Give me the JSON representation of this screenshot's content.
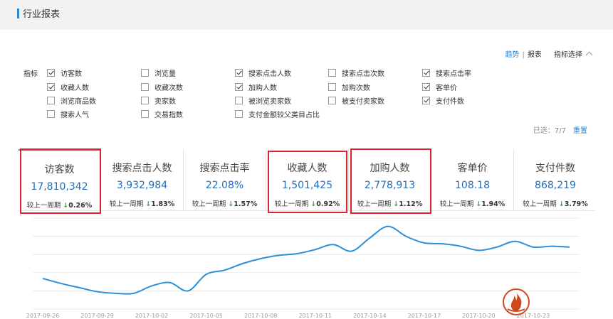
{
  "header": {
    "title": "行业报表"
  },
  "top_links": {
    "trend": "趋势",
    "separator": "|",
    "report": "报表",
    "indicator_select": "指标选择"
  },
  "indicators": {
    "label": "指标",
    "items": [
      {
        "label": "访客数",
        "checked": true
      },
      {
        "label": "浏览量",
        "checked": false
      },
      {
        "label": "搜索点击人数",
        "checked": true
      },
      {
        "label": "搜索点击次数",
        "checked": false
      },
      {
        "label": "搜索点击率",
        "checked": true
      },
      {
        "label": "收藏人数",
        "checked": true
      },
      {
        "label": "收藏次数",
        "checked": false
      },
      {
        "label": "加购人数",
        "checked": true
      },
      {
        "label": "加购次数",
        "checked": false
      },
      {
        "label": "客单价",
        "checked": true
      },
      {
        "label": "浏览商品数",
        "checked": false
      },
      {
        "label": "卖家数",
        "checked": false
      },
      {
        "label": "被浏览卖家数",
        "checked": false
      },
      {
        "label": "被支付卖家数",
        "checked": false
      },
      {
        "label": "支付件数",
        "checked": true
      },
      {
        "label": "搜索人气",
        "checked": false
      },
      {
        "label": "交易指数",
        "checked": false
      },
      {
        "label": "支付金额较父类目占比",
        "checked": false
      }
    ]
  },
  "selection": {
    "text": "已选：7/7",
    "reset": "重置"
  },
  "cards": [
    {
      "title": "访客数",
      "value": "17,810,342",
      "cmp_label": "较上一周期",
      "arrow": "↓",
      "pct": "0.26%",
      "highlighted": true,
      "active": true
    },
    {
      "title": "搜索点击人数",
      "value": "3,932,984",
      "cmp_label": "较上一周期",
      "arrow": "↓",
      "pct": "1.83%",
      "highlighted": false,
      "active": false
    },
    {
      "title": "搜索点击率",
      "value": "22.08%",
      "cmp_label": "较上一周期",
      "arrow": "↓",
      "pct": "1.57%",
      "highlighted": false,
      "active": false
    },
    {
      "title": "收藏人数",
      "value": "1,501,425",
      "cmp_label": "较上一周期",
      "arrow": "↓",
      "pct": "0.92%",
      "highlighted": true,
      "active": false
    },
    {
      "title": "加购人数",
      "value": "2,778,913",
      "cmp_label": "较上一周期",
      "arrow": "↓",
      "pct": "1.12%",
      "highlighted": true,
      "active": false
    },
    {
      "title": "客单价",
      "value": "108.18",
      "cmp_label": "较上一周期",
      "arrow": "↓",
      "pct": "1.94%",
      "highlighted": false,
      "active": false
    },
    {
      "title": "支付件数",
      "value": "868,219",
      "cmp_label": "较上一周期",
      "arrow": "↓",
      "pct": "3.79%",
      "highlighted": false,
      "active": false
    }
  ],
  "colors": {
    "accent": "#2a87d4",
    "highlight_box": "#d9232f",
    "line": "#2d8fd8",
    "down_arrow": "#3a9a3a"
  },
  "chart_data": {
    "type": "line",
    "x": [
      "2017-09-26",
      "2017-09-27",
      "2017-09-28",
      "2017-09-29",
      "2017-09-30",
      "2017-10-01",
      "2017-10-02",
      "2017-10-03",
      "2017-10-04",
      "2017-10-05",
      "2017-10-06",
      "2017-10-07",
      "2017-10-08",
      "2017-10-09",
      "2017-10-10",
      "2017-10-11",
      "2017-10-12",
      "2017-10-13",
      "2017-10-14",
      "2017-10-15",
      "2017-10-16",
      "2017-10-17",
      "2017-10-18",
      "2017-10-19",
      "2017-10-20",
      "2017-10-21",
      "2017-10-22",
      "2017-10-23",
      "2017-10-24",
      "2017-10-25"
    ],
    "tick_labels": [
      "2017-09-26",
      "2017-09-29",
      "2017-10-02",
      "2017-10-05",
      "2017-10-08",
      "2017-10-11",
      "2017-10-14",
      "2017-10-17",
      "2017-10-20",
      "2017-10-23"
    ],
    "series": [
      {
        "values": [
          37,
          31,
          26,
          21,
          19,
          19,
          28,
          32,
          22,
          42,
          47,
          55,
          61,
          65,
          67,
          72,
          78,
          70,
          86,
          100,
          88,
          80,
          79,
          76,
          71,
          75,
          82,
          75,
          76,
          75
        ]
      }
    ],
    "ylim": [
      0,
      110
    ],
    "grid": true
  }
}
